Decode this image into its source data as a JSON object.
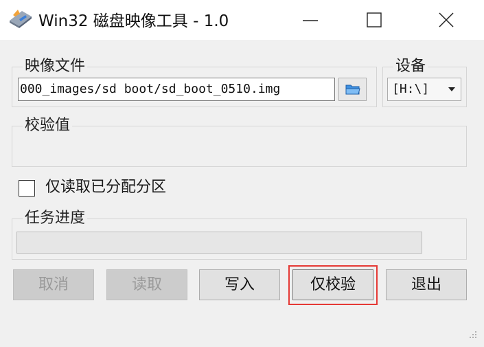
{
  "window": {
    "title": "Win32 磁盘映像工具 - 1.0",
    "icons": [
      "app-icon",
      "minimize-icon",
      "maximize-icon",
      "close-icon"
    ]
  },
  "image_file": {
    "label": "映像文件",
    "path": "000_images/sd boot/sd_boot_0510.img",
    "browse_icon": "folder-icon"
  },
  "device": {
    "label": "设备",
    "selected": "[H:\\]"
  },
  "checksum": {
    "label": "校验值",
    "value": ""
  },
  "read_only_allocated": {
    "label": "仅读取已分配分区",
    "checked": false
  },
  "progress": {
    "label": "任务进度",
    "percent": 0
  },
  "buttons": {
    "cancel": "取消",
    "read": "读取",
    "write": "写入",
    "verify_only": "仅校验",
    "exit": "退出"
  },
  "colors": {
    "highlight": "#e53935",
    "progress_fill": "#06b025"
  }
}
